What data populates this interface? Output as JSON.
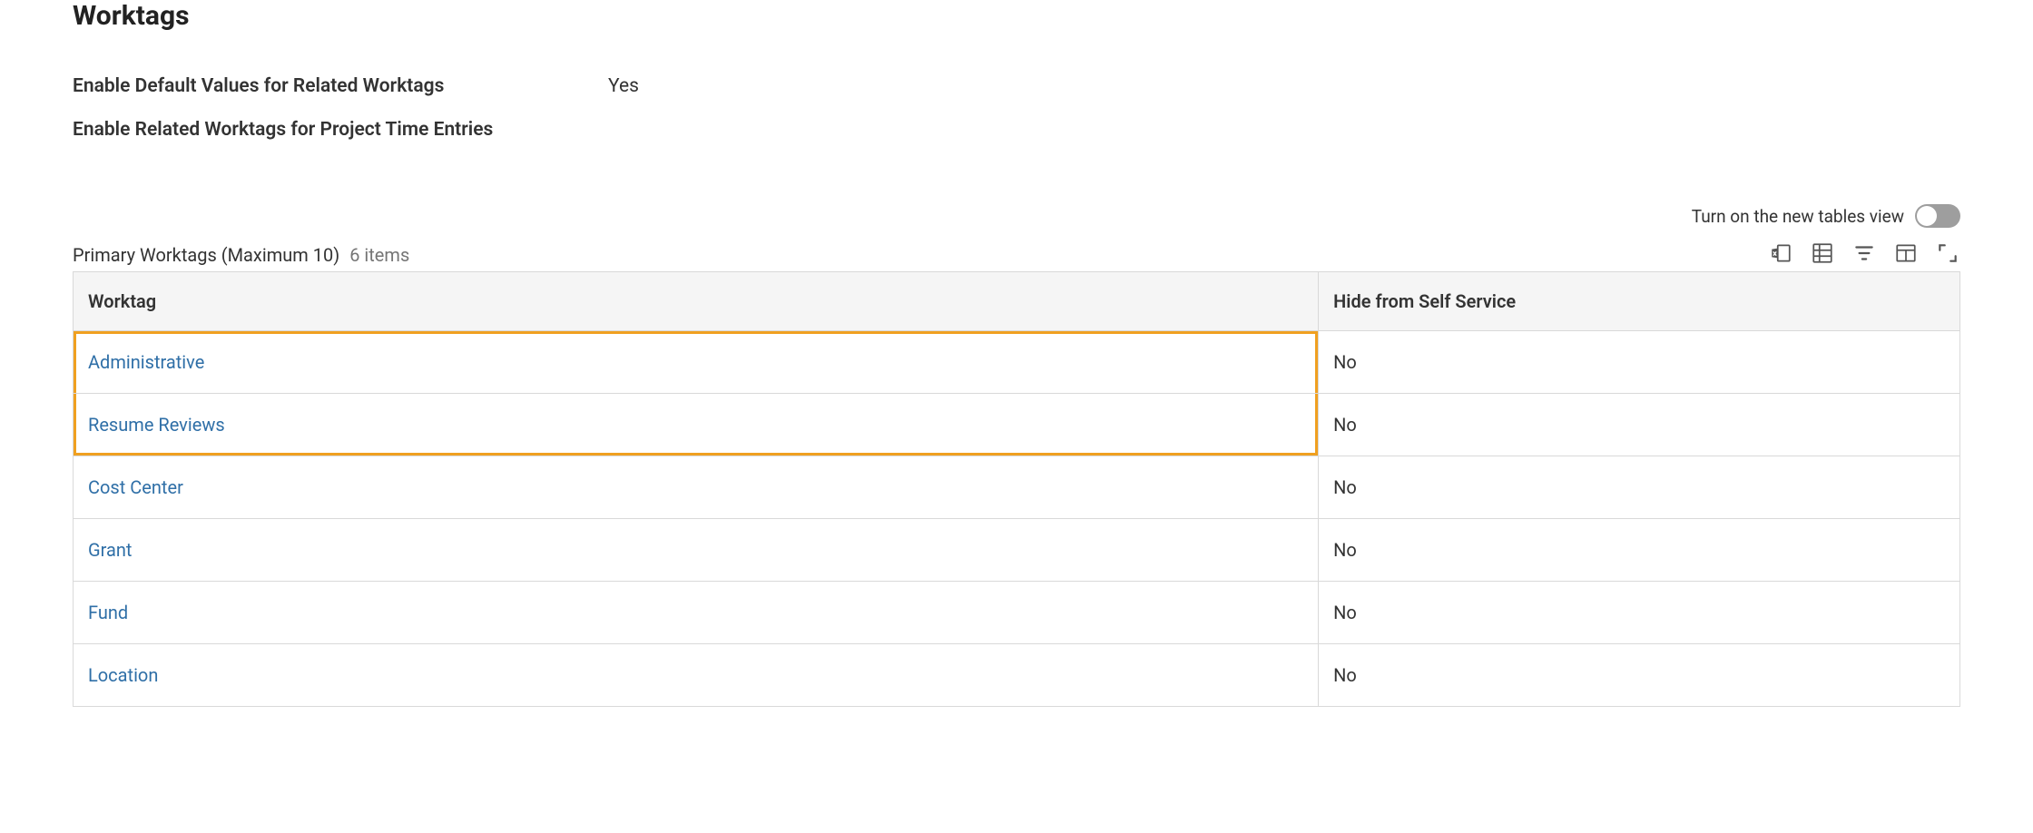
{
  "section": {
    "title": "Worktags"
  },
  "fields": {
    "default_values_label": "Enable Default Values for Related Worktags",
    "default_values_value": "Yes",
    "project_time_label": "Enable Related Worktags for Project Time Entries"
  },
  "toggle": {
    "label": "Turn on the new tables view"
  },
  "table": {
    "caption": "Primary Worktags (Maximum 10)",
    "count_text": "6 items",
    "columns": {
      "worktag": "Worktag",
      "hide": "Hide from Self Service"
    },
    "rows": [
      {
        "worktag": "Administrative",
        "hide": "No"
      },
      {
        "worktag": "Resume Reviews",
        "hide": "No"
      },
      {
        "worktag": "Cost Center",
        "hide": "No"
      },
      {
        "worktag": "Grant",
        "hide": "No"
      },
      {
        "worktag": "Fund",
        "hide": "No"
      },
      {
        "worktag": "Location",
        "hide": "No"
      }
    ]
  },
  "highlight_rows": [
    0,
    1
  ]
}
